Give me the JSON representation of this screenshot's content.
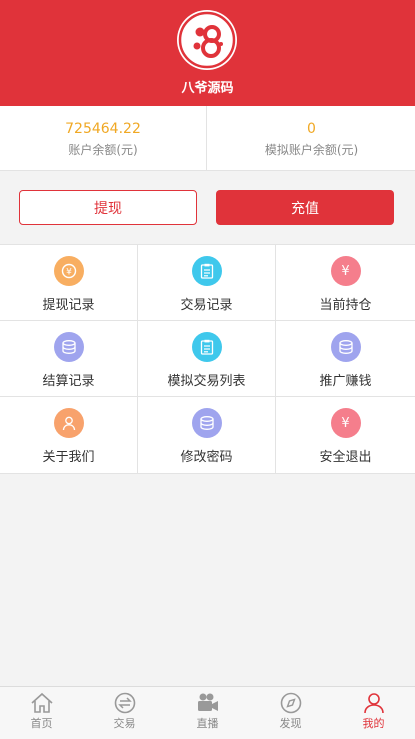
{
  "header": {
    "site_name": "八爷源码"
  },
  "balances": [
    {
      "value": "725464.22",
      "label": "账户余额(元)"
    },
    {
      "value": "0",
      "label": "模拟账户余额(元)"
    }
  ],
  "actions": {
    "withdraw": "提现",
    "recharge": "充值"
  },
  "menu": [
    {
      "label": "提现记录",
      "icon": "coin-icon",
      "color": "#f8ae61"
    },
    {
      "label": "交易记录",
      "icon": "clipboard-icon",
      "color": "#3fc8ec"
    },
    {
      "label": "当前持仓",
      "icon": "yen-icon",
      "color": "#f57e8c"
    },
    {
      "label": "结算记录",
      "icon": "database-icon",
      "color": "#9fa4ee"
    },
    {
      "label": "模拟交易列表",
      "icon": "clipboard-icon",
      "color": "#3fc8ec"
    },
    {
      "label": "推广赚钱",
      "icon": "database-icon",
      "color": "#9fa4ee"
    },
    {
      "label": "关于我们",
      "icon": "user-icon",
      "color": "#f8a26c"
    },
    {
      "label": "修改密码",
      "icon": "database-icon",
      "color": "#9fa4ee"
    },
    {
      "label": "安全退出",
      "icon": "yen-icon",
      "color": "#f57e8c"
    }
  ],
  "tabbar": [
    {
      "label": "首页",
      "icon": "home-icon"
    },
    {
      "label": "交易",
      "icon": "exchange-icon"
    },
    {
      "label": "直播",
      "icon": "video-camera-icon"
    },
    {
      "label": "发现",
      "icon": "compass-icon"
    },
    {
      "label": "我的",
      "icon": "person-icon",
      "active": true
    }
  ],
  "colors": {
    "brand": "#e0333a",
    "balance": "#f0a824"
  }
}
